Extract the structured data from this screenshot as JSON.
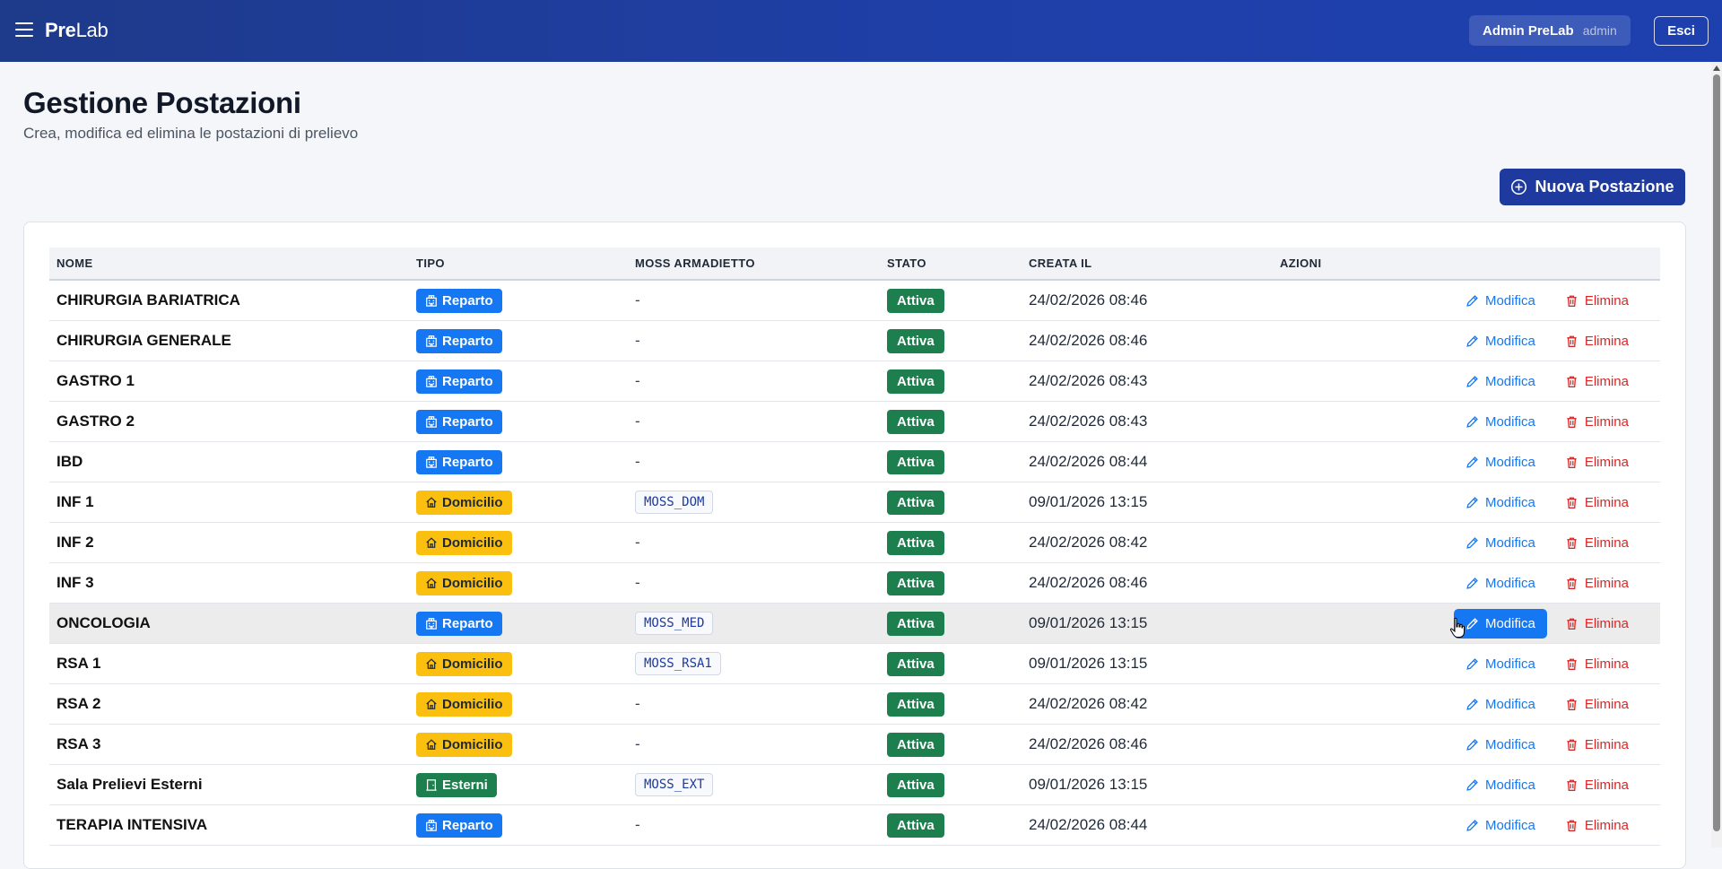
{
  "header": {
    "brand_bold": "Pre",
    "brand_light": "Lab",
    "user_name": "Admin PreLab",
    "user_role": "admin",
    "logout_label": "Esci"
  },
  "page": {
    "title": "Gestione Postazioni",
    "subtitle": "Crea, modifica ed elimina le postazioni di prelievo",
    "new_button_label": "Nuova Postazione"
  },
  "table": {
    "columns": [
      "NOME",
      "TIPO",
      "MOSS ARMADIETTO",
      "STATO",
      "CREATA IL",
      "AZIONI"
    ],
    "edit_label": "Modifica",
    "delete_label": "Elimina",
    "rows": [
      {
        "name": "CHIRURGIA BARIATRICA",
        "type": "Reparto",
        "moss": "-",
        "status": "Attiva",
        "created": "24/02/2026 08:46"
      },
      {
        "name": "CHIRURGIA GENERALE",
        "type": "Reparto",
        "moss": "-",
        "status": "Attiva",
        "created": "24/02/2026 08:46"
      },
      {
        "name": "GASTRO 1",
        "type": "Reparto",
        "moss": "-",
        "status": "Attiva",
        "created": "24/02/2026 08:43"
      },
      {
        "name": "GASTRO 2",
        "type": "Reparto",
        "moss": "-",
        "status": "Attiva",
        "created": "24/02/2026 08:43"
      },
      {
        "name": "IBD",
        "type": "Reparto",
        "moss": "-",
        "status": "Attiva",
        "created": "24/02/2026 08:44"
      },
      {
        "name": "INF 1",
        "type": "Domicilio",
        "moss": "MOSS_DOM",
        "status": "Attiva",
        "created": "09/01/2026 13:15"
      },
      {
        "name": "INF 2",
        "type": "Domicilio",
        "moss": "-",
        "status": "Attiva",
        "created": "24/02/2026 08:42"
      },
      {
        "name": "INF 3",
        "type": "Domicilio",
        "moss": "-",
        "status": "Attiva",
        "created": "24/02/2026 08:46"
      },
      {
        "name": "ONCOLOGIA",
        "type": "Reparto",
        "moss": "MOSS_MED",
        "status": "Attiva",
        "created": "09/01/2026 13:15",
        "hovered": true
      },
      {
        "name": "RSA 1",
        "type": "Domicilio",
        "moss": "MOSS_RSA1",
        "status": "Attiva",
        "created": "09/01/2026 13:15"
      },
      {
        "name": "RSA 2",
        "type": "Domicilio",
        "moss": "-",
        "status": "Attiva",
        "created": "24/02/2026 08:42"
      },
      {
        "name": "RSA 3",
        "type": "Domicilio",
        "moss": "-",
        "status": "Attiva",
        "created": "24/02/2026 08:46"
      },
      {
        "name": "Sala Prelievi Esterni",
        "type": "Esterni",
        "moss": "MOSS_EXT",
        "status": "Attiva",
        "created": "09/01/2026 13:15"
      },
      {
        "name": "TERAPIA INTENSIVA",
        "type": "Reparto",
        "moss": "-",
        "status": "Attiva",
        "created": "24/02/2026 08:44"
      }
    ]
  },
  "colors": {
    "header_bg": "#1e3a8a",
    "primary": "#1e3a9f",
    "reparto": "#1677f2",
    "domicilio": "#fbbf0f",
    "esterni": "#1c7f4d",
    "status_active": "#1c7f4d",
    "danger": "#dc2626"
  },
  "icons": {
    "menu": "hamburger-icon",
    "new": "plus-circle-icon",
    "reparto": "hospital-icon",
    "domicilio": "house-icon",
    "esterni": "door-icon",
    "edit": "pencil-icon",
    "delete": "trash-icon"
  }
}
